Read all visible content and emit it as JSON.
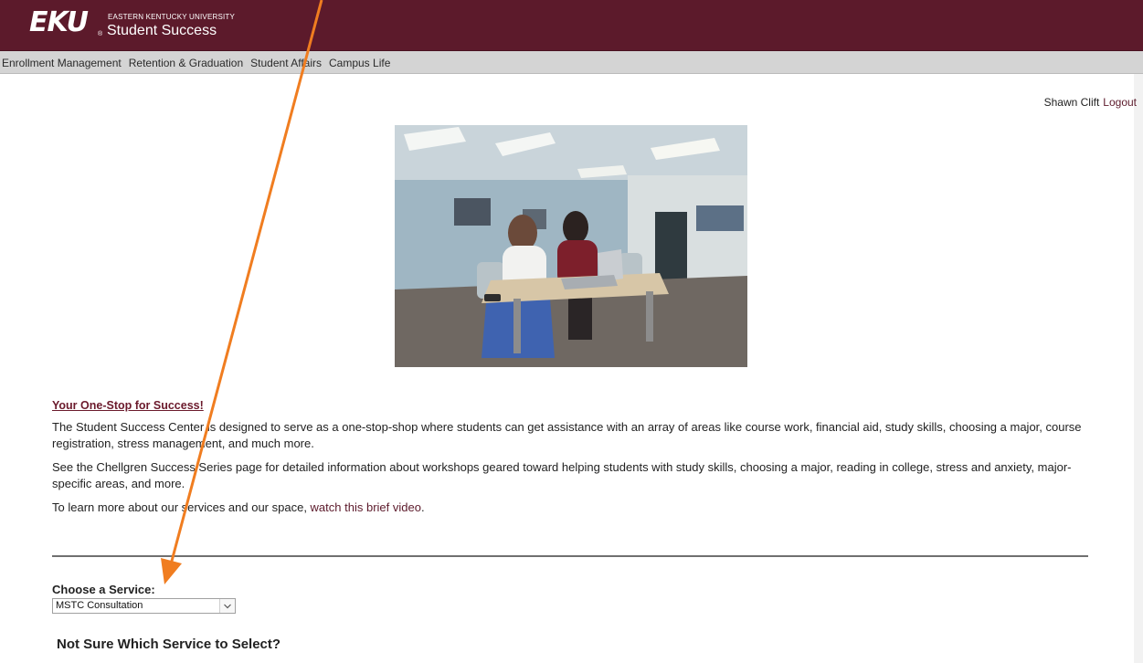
{
  "header": {
    "logo_text": "EKU",
    "logo_reg": "®",
    "university_name": "EASTERN KENTUCKY UNIVERSITY",
    "site_title": "Student Success",
    "bg_color": "#5c1a2b"
  },
  "nav": {
    "items": [
      {
        "label": "Enrollment Management"
      },
      {
        "label": "Retention & Graduation"
      },
      {
        "label": "Student Affairs"
      },
      {
        "label": "Campus Life"
      }
    ]
  },
  "user": {
    "name": "Shawn Clift",
    "logout_label": "Logout"
  },
  "content": {
    "tagline": "Your One-Stop for Success!",
    "para1": "The Student Success Center is designed to serve as a one-stop-shop where students can get assistance with an array of areas like course work, financial aid, study skills, choosing a major, course registration, stress management, and much more.",
    "para2": "See the Chellgren Success Series page for detailed information about workshops geared toward helping students with study skills, choosing a major, reading in college, stress and anxiety, major-specific areas, and more.",
    "para3_prefix": "To learn more about our services and our space, ",
    "para3_link": "watch this brief video",
    "para3_suffix": "."
  },
  "service": {
    "label": "Choose a Service:",
    "selected": "MSTC Consultation"
  },
  "help": {
    "heading": "Not Sure Which Service to Select?"
  },
  "annotation": {
    "arrow_color": "#f07d20"
  },
  "icons": {
    "select_arrow": "chevron-down-icon"
  }
}
